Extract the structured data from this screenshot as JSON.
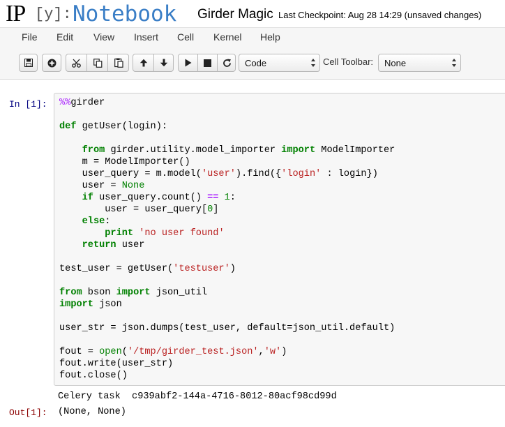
{
  "header": {
    "logo_ip": "IP",
    "logo_y": "[y]:",
    "logo_word": "Notebook",
    "notebook_name": "Girder Magic",
    "checkpoint": "Last Checkpoint: Aug 28 14:29 (unsaved changes)"
  },
  "menubar": {
    "items": [
      "File",
      "Edit",
      "View",
      "Insert",
      "Cell",
      "Kernel",
      "Help"
    ]
  },
  "toolbar": {
    "buttons": [
      "save-icon",
      "add-cell-icon",
      "cut-icon",
      "copy-icon",
      "paste-icon",
      "move-up-icon",
      "move-down-icon",
      "run-icon",
      "stop-icon",
      "restart-icon"
    ],
    "cell_type": "Code",
    "cell_toolbar_label": "Cell Toolbar:",
    "cell_toolbar_value": "None"
  },
  "cell": {
    "in_prompt": "In [1]:",
    "code_lines": [
      "%%girder",
      "",
      "def getUser(login):",
      "",
      "    from girder.utility.model_importer import ModelImporter",
      "    m = ModelImporter()",
      "    user_query = m.model('user').find({'login' : login})",
      "    user = None",
      "    if user_query.count() == 1:",
      "        user = user_query[0]",
      "    else:",
      "        print 'no user found'",
      "    return user",
      "",
      "test_user = getUser('testuser')",
      "",
      "from bson import json_util",
      "import json",
      "",
      "user_str = json.dumps(test_user, default=json_util.default)",
      "",
      "fout = open('/tmp/girder_test.json','w')",
      "fout.write(user_str)",
      "fout.close()"
    ],
    "stream_output": "Celery task  c939abf2-144a-4716-8012-80acf98cd99d",
    "out_prompt": "Out[1]:",
    "result": "(None, None)"
  },
  "colors": {
    "keyword": "#008000",
    "string": "#ba2121",
    "magic": "#aa22ff",
    "in_prompt": "#000080",
    "out_prompt": "#8b0000",
    "logo": "#3a7ec6"
  }
}
